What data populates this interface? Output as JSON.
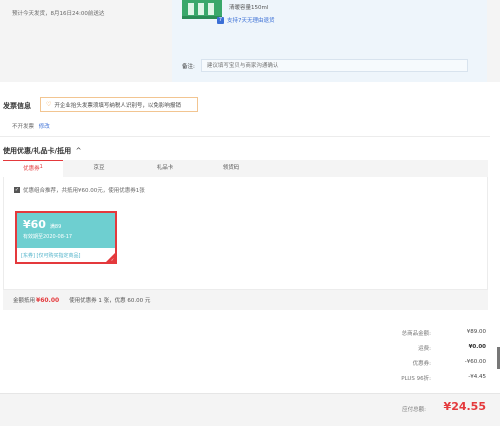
{
  "order": {
    "delivery_note": "预计今天发货，8月16日24:00前送达",
    "product_spec": "清暖容量150ml",
    "return_badge": "7",
    "return_policy": "支持7天无理由退货",
    "remark_label": "备注:",
    "remark_placeholder": "建议填写宝贝与商家沟通确认"
  },
  "invoice": {
    "title": "发票信息",
    "tip": "开企业抬头发票须填写纳税人识别号，以免影响报销",
    "status": "不开发票",
    "edit_label": "修改"
  },
  "coupon": {
    "section_title": "使用优惠/礼品卡/抵用",
    "chevron": "^",
    "tabs": [
      {
        "label": "优惠券",
        "sup": "1"
      },
      {
        "label": "京豆",
        "sup": ""
      },
      {
        "label": "礼品卡",
        "sup": ""
      },
      {
        "label": "领货码",
        "sup": ""
      }
    ],
    "option_text": "优惠组合推荐，共抵用¥60.00元，使用优惠券1张",
    "card": {
      "amount": "¥60",
      "condition": "满89",
      "expiry": "有效期至2020-08-17",
      "tags": "[东券] [仅可购买指定商品]"
    },
    "applied_label": "金额抵用",
    "applied_amount": "¥60.00",
    "applied_detail": "使用优惠券 1 张，优惠 60.00 元"
  },
  "summary": {
    "rows": [
      {
        "label": "总商品金额:",
        "value": "¥89.00"
      },
      {
        "label": "运费:",
        "value": "¥0.00"
      },
      {
        "label": "优惠券:",
        "value": "-¥60.00"
      },
      {
        "label": "PLUS 96折:",
        "value": "-¥4.45"
      }
    ],
    "total_label": "应付总额:",
    "total_value": "¥24.55"
  },
  "colors": {
    "accent_red": "#e4393c",
    "link_blue": "#3b6fd6",
    "coupon_teal": "#6ecfd0",
    "tip_orange": "#f08a1c"
  },
  "icons": [
    "return-icon",
    "tip-warning-icon",
    "checkbox-icon",
    "selected-check-icon",
    "product-thumbnail"
  ]
}
